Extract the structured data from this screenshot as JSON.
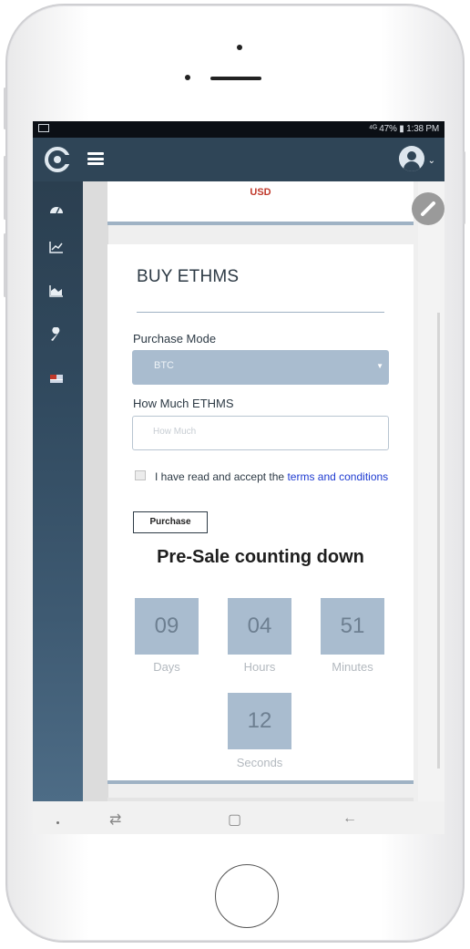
{
  "status_bar": {
    "right_text": "⁴ᴳ 47% ▮ 1:38 PM"
  },
  "header": {
    "menu_icon": "hamburger-menu-icon",
    "logo_icon": "app-logo-icon",
    "avatar_icon": "user-avatar-icon"
  },
  "sidebar": {
    "items": [
      {
        "icon": "dashboard-icon"
      },
      {
        "icon": "line-chart-icon"
      },
      {
        "icon": "area-chart-icon"
      },
      {
        "icon": "wrench-icon"
      },
      {
        "icon": "flag-icon"
      }
    ]
  },
  "top_card": {
    "currency": "USD"
  },
  "buy_card": {
    "title": "BUY ETHMS",
    "purchase_mode_label": "Purchase Mode",
    "purchase_mode_value": "BTC",
    "amount_label": "How Much ETHMS",
    "amount_placeholder": "How Much",
    "terms_prefix": "I have read and accept the ",
    "terms_link": "terms and conditions",
    "purchase_button": "Purchase"
  },
  "countdown": {
    "title": "Pre-Sale counting down",
    "days": {
      "value": "09",
      "label": "Days"
    },
    "hours": {
      "value": "04",
      "label": "Hours"
    },
    "minutes": {
      "value": "51",
      "label": "Minutes"
    },
    "seconds": {
      "value": "12",
      "label": "Seconds"
    }
  },
  "colors": {
    "appbar": "#2f4557",
    "accent_blue": "#a9bccf",
    "usd_red": "#c0392b",
    "link": "#1e3bd1"
  }
}
